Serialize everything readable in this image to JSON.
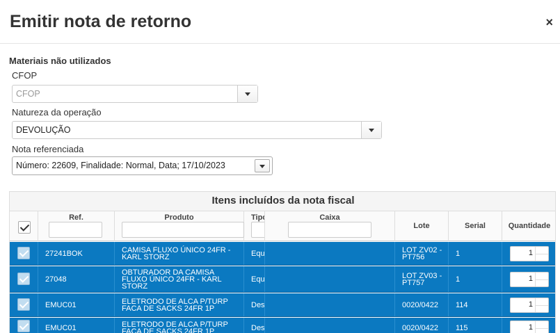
{
  "modal": {
    "title": "Emitir nota de retorno",
    "close_glyph": "×"
  },
  "section_title": "Materiais não utilizados",
  "fields": {
    "cfop": {
      "label": "CFOP",
      "placeholder": "CFOP"
    },
    "natureza": {
      "label": "Natureza da operação",
      "value": "DEVOLUÇÃO"
    },
    "nota": {
      "label": "Nota referenciada",
      "value": "Número: 22609, Finalidade: Normal, Data; 17/10/2023"
    }
  },
  "table": {
    "caption": "Itens incluídos da nota fiscal",
    "headers": {
      "ref": "Ref.",
      "produto": "Produto",
      "tipo": "Tipo",
      "caixa": "Caixa",
      "lote": "Lote",
      "serial": "Serial",
      "quantidade": "Quantidade"
    },
    "rows": [
      {
        "ref": "27241BOK",
        "produto": "CAMISA FLUXO ÚNICO 24FR - KARL STORZ",
        "tipo": "Equ",
        "caixa": "",
        "lote": "LOT ZV02 - PT756",
        "serial": "1",
        "quantidade": "1"
      },
      {
        "ref": "27048",
        "produto": "OBTURADOR DA CAMISA FLUXO ÚNICO 24FR - KARL STORZ",
        "tipo": "Equ",
        "caixa": "",
        "lote": "LOT ZV03 - PT757",
        "serial": "1",
        "quantidade": "1"
      },
      {
        "ref": "EMUC01",
        "produto": "ELETRODO DE ALCA P/TURP FACA DE SACKS 24FR 1P",
        "tipo": "Des",
        "caixa": "",
        "lote": "0020/0422",
        "serial": "114",
        "quantidade": "1"
      },
      {
        "ref": "EMUC01",
        "produto": "ELETRODO DE ALCA P/TURP FACA DE SACKS 24FR 1P",
        "tipo": "Des",
        "caixa": "",
        "lote": "0020/0422",
        "serial": "115",
        "quantidade": "1"
      }
    ]
  },
  "colors": {
    "row_selected": "#0b79c1",
    "header_bg": "#fafafa"
  }
}
